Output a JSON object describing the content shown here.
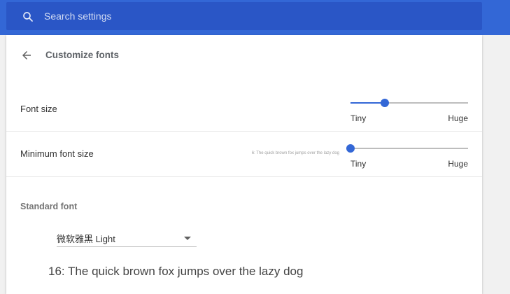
{
  "search": {
    "placeholder": "Search settings"
  },
  "header": {
    "title": "Customize fonts"
  },
  "font_size": {
    "label": "Font size",
    "min_label": "Tiny",
    "max_label": "Huge",
    "level": 0.29
  },
  "min_font_size": {
    "label": "Minimum font size",
    "preview": "6: The quick brown fox jumps over the lazy dog",
    "min_label": "Tiny",
    "max_label": "Huge",
    "level": 0
  },
  "standard_font": {
    "title": "Standard font",
    "selected": "微软雅黑 Light",
    "preview": "16: The quick brown fox jumps over the lazy dog"
  },
  "colors": {
    "accent": "#3367d6",
    "search_bg": "#2a56c6"
  }
}
